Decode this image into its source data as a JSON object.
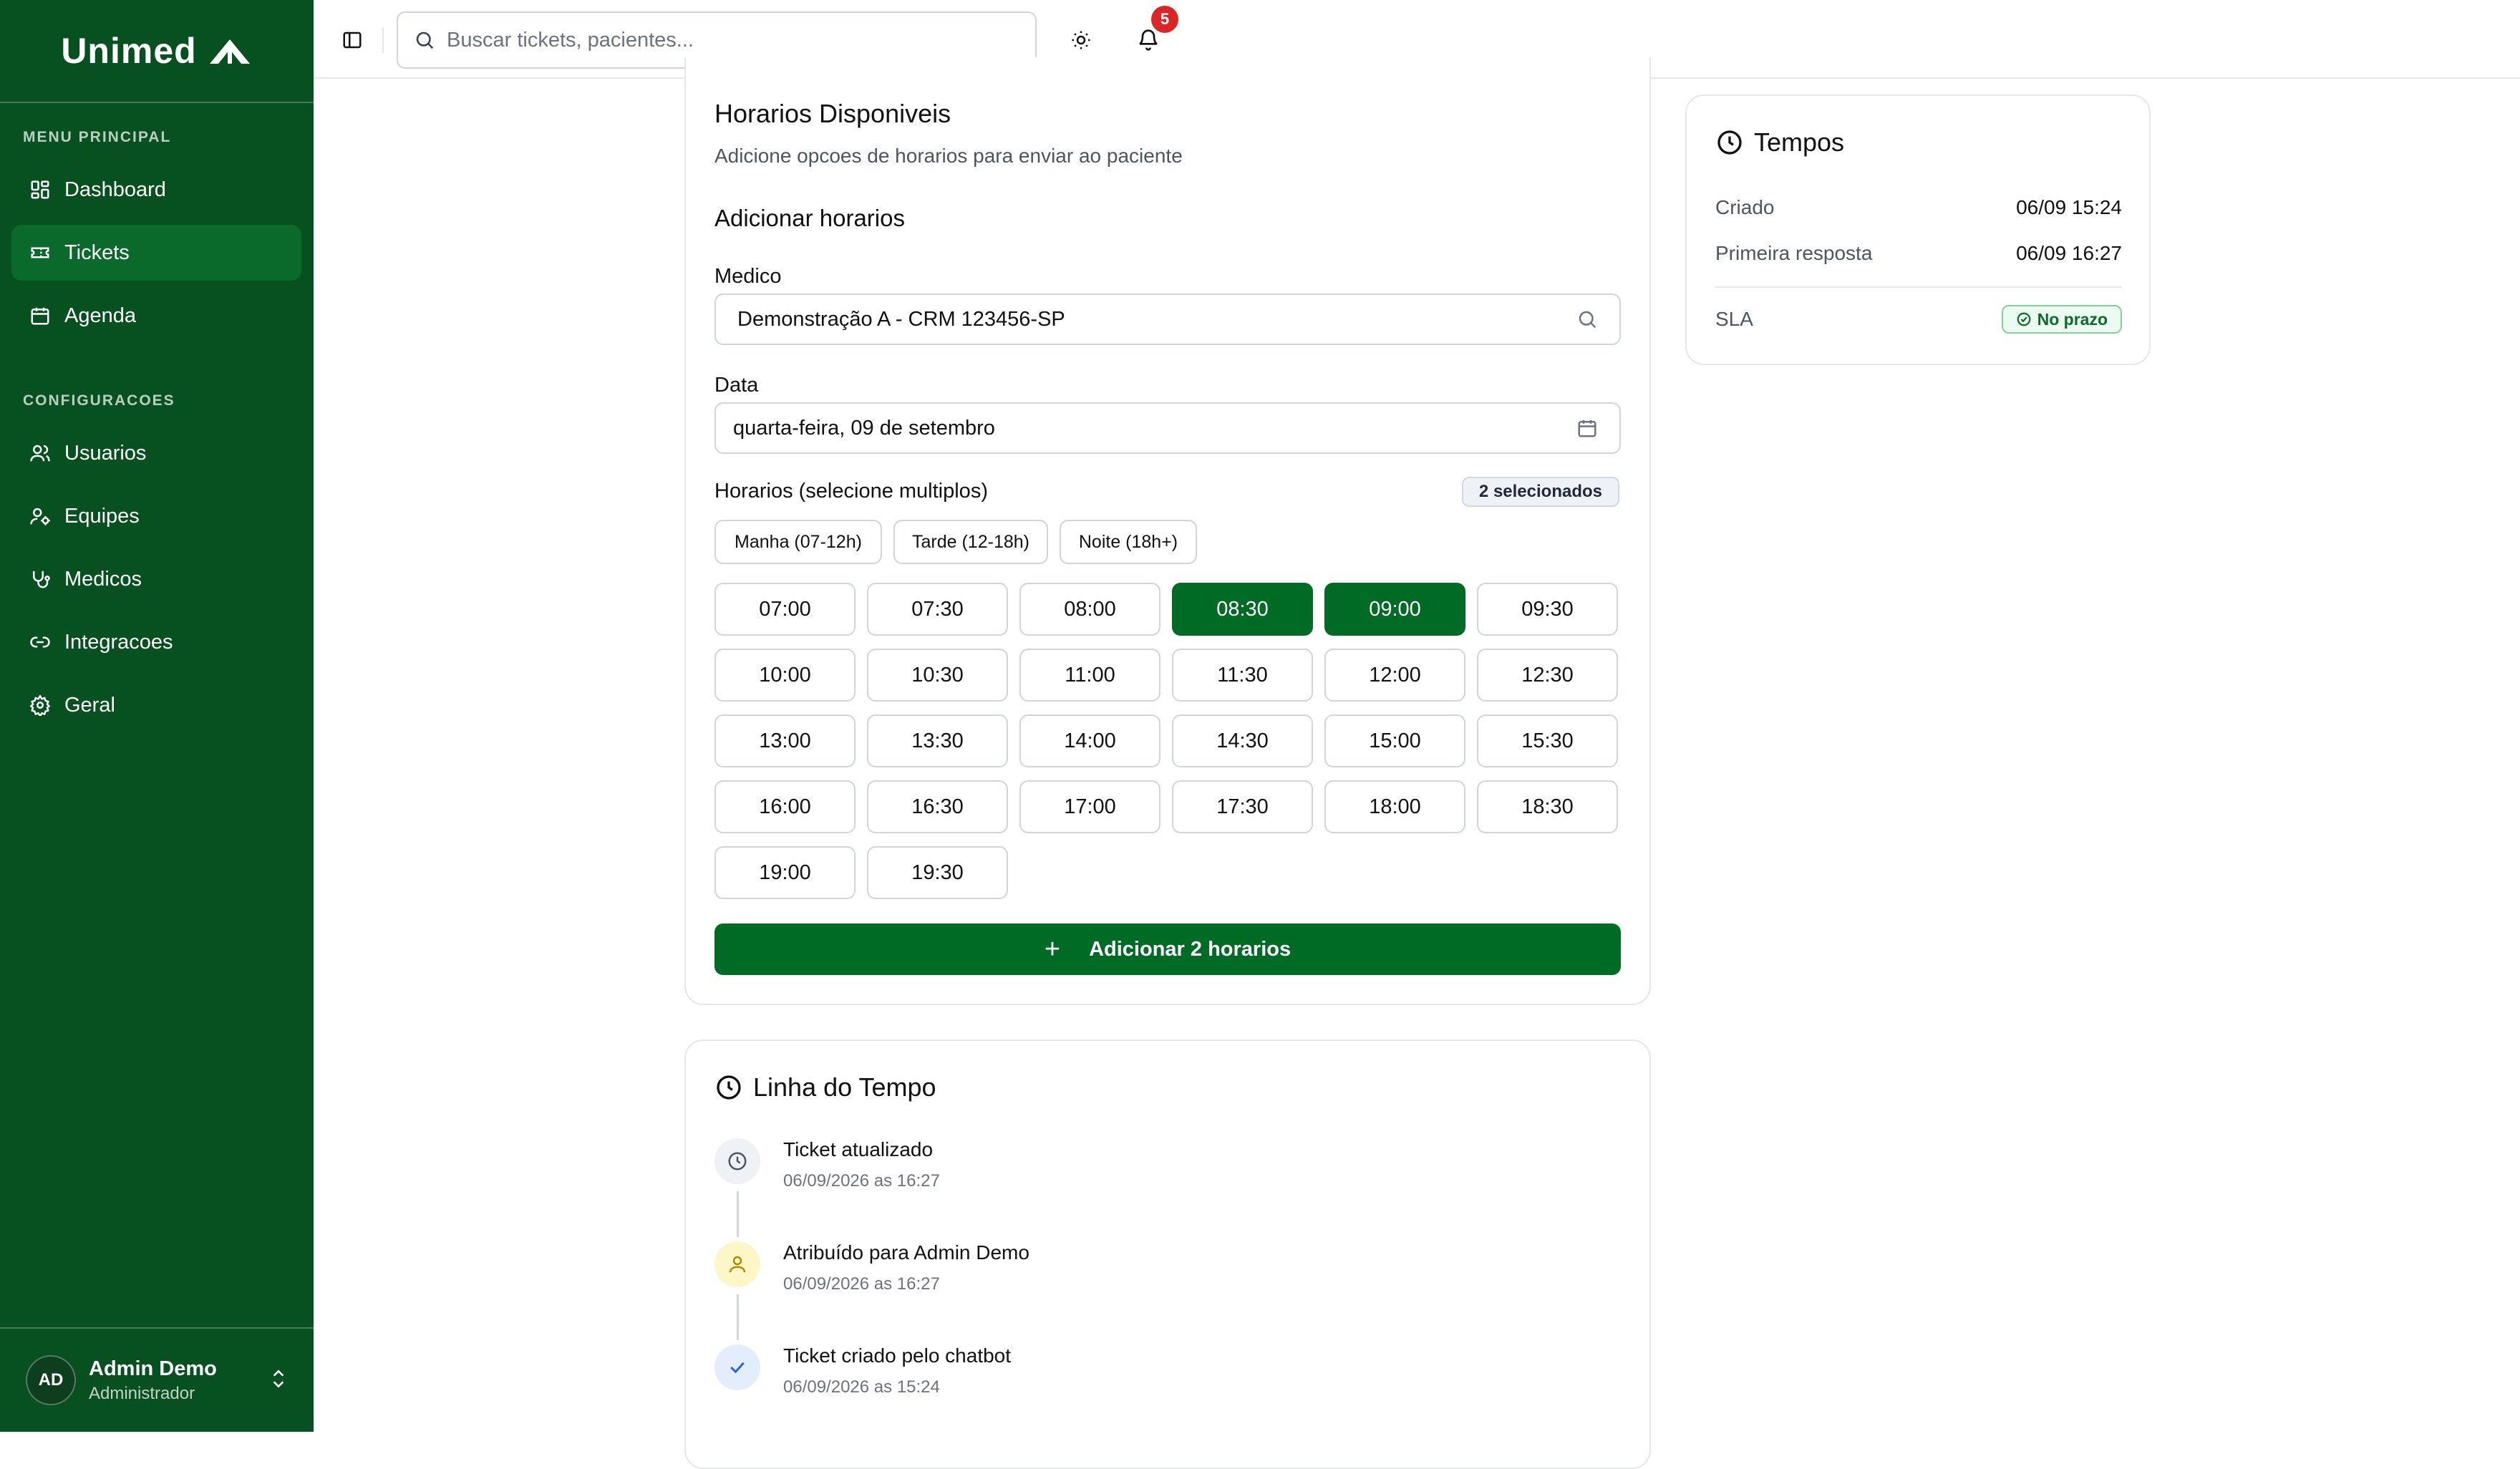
{
  "sidebar": {
    "logo": "Unimed",
    "section_main": "MENU PRINCIPAL",
    "section_config": "CONFIGURACOES",
    "main_items": [
      {
        "label": "Dashboard",
        "icon": "dashboard-icon"
      },
      {
        "label": "Tickets",
        "icon": "ticket-icon",
        "active": true
      },
      {
        "label": "Agenda",
        "icon": "calendar-icon"
      }
    ],
    "config_items": [
      {
        "label": "Usuarios",
        "icon": "users-icon"
      },
      {
        "label": "Equipes",
        "icon": "team-icon"
      },
      {
        "label": "Medicos",
        "icon": "stethoscope-icon"
      },
      {
        "label": "Integracoes",
        "icon": "link-icon"
      },
      {
        "label": "Geral",
        "icon": "gear-icon"
      }
    ],
    "user": {
      "initials": "AD",
      "name": "Admin Demo",
      "role": "Administrador"
    }
  },
  "topbar": {
    "search_placeholder": "Buscar tickets, pacientes...",
    "notification_count": "5"
  },
  "horarios": {
    "title": "Horarios Disponiveis",
    "subtitle": "Adicione opcoes de horarios para enviar ao paciente",
    "section_title": "Adicionar horarios",
    "medico_label": "Medico",
    "medico_value": "Demonstração A - CRM 123456-SP",
    "data_label": "Data",
    "data_value": "quarta-feira, 09 de setembro",
    "slots_label": "Horarios (selecione multiplos)",
    "selected_badge": "2 selecionados",
    "filters": [
      "Manha (07-12h)",
      "Tarde (12-18h)",
      "Noite (18h+)"
    ],
    "slots": [
      "07:00",
      "07:30",
      "08:00",
      "08:30",
      "09:00",
      "09:30",
      "10:00",
      "10:30",
      "11:00",
      "11:30",
      "12:00",
      "12:30",
      "13:00",
      "13:30",
      "14:00",
      "14:30",
      "15:00",
      "15:30",
      "16:00",
      "16:30",
      "17:00",
      "17:30",
      "18:00",
      "18:30",
      "19:00",
      "19:30"
    ],
    "selected_slots": [
      "08:30",
      "09:00"
    ],
    "add_button": "Adicionar 2 horarios"
  },
  "tempos": {
    "title": "Tempos",
    "criado_label": "Criado",
    "criado_value": "06/09 15:24",
    "primeira_label": "Primeira resposta",
    "primeira_value": "06/09 16:27",
    "sla_label": "SLA",
    "sla_value": "No prazo"
  },
  "timeline": {
    "title": "Linha do Tempo",
    "events": [
      {
        "title": "Ticket atualizado",
        "date": "06/09/2026 as 16:27",
        "icon": "clock-icon"
      },
      {
        "title": "Atribuído para Admin Demo",
        "date": "06/09/2026 as 16:27",
        "icon": "user-icon"
      },
      {
        "title": "Ticket criado pelo chatbot",
        "date": "06/09/2026 as 15:24",
        "icon": "check-icon"
      }
    ]
  },
  "colors": {
    "sidebar_bg": "#07501f",
    "primary": "#006b25",
    "badge_red": "#dc2626"
  }
}
